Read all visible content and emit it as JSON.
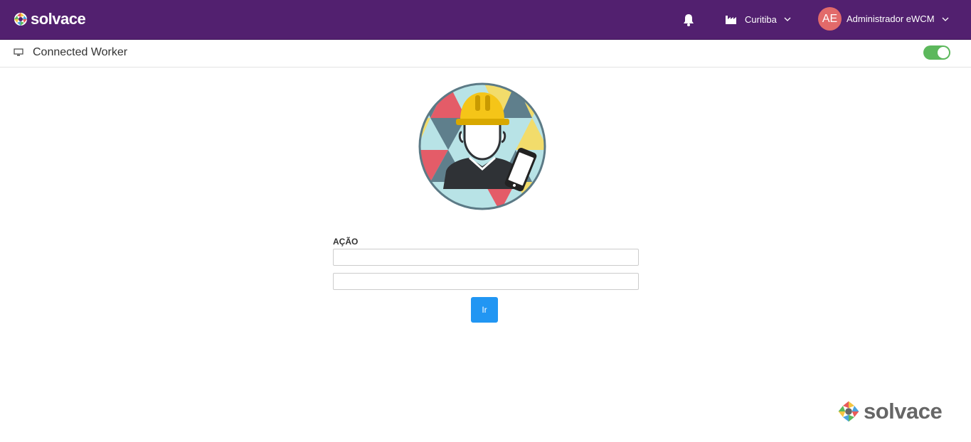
{
  "header": {
    "brand": "solvace",
    "site": "Curitiba",
    "user_initials": "AE",
    "user_name": "Administrador eWCM",
    "colors": {
      "bar": "#52206f",
      "avatar": "#e26a6a"
    }
  },
  "subheader": {
    "title": "Connected Worker",
    "toggle_on": true,
    "toggle_color": "#5cb85c"
  },
  "form": {
    "label": "AÇÃO",
    "field1_value": "",
    "field2_value": "",
    "button_label": "Ir",
    "button_color": "#2196f3"
  },
  "footer": {
    "brand": "solvace"
  },
  "icons": [
    "solvace-logo-icon",
    "bell-icon",
    "factory-icon",
    "chevron-down-icon",
    "monitor-icon",
    "connected-worker-illustration"
  ]
}
